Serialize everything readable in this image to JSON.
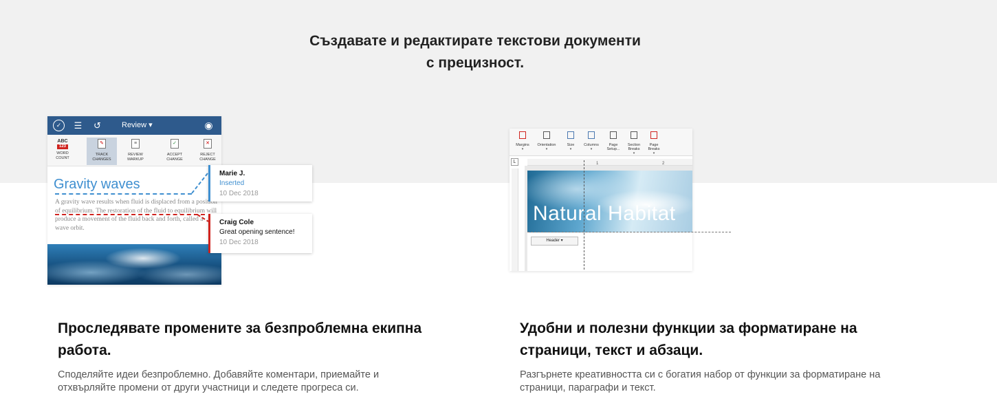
{
  "hero": {
    "line1": "Създавате и редактирате текстови документи",
    "line2": "с прецизност."
  },
  "mobile_mock": {
    "toolbar": {
      "icons": [
        "check-circle-icon",
        "list-icon",
        "undo-icon",
        "eye-icon"
      ],
      "menu_label": "Review ▾"
    },
    "tools": [
      {
        "label1": "WORD",
        "label2": "COUNT",
        "badge_top": "ABC",
        "badge_bottom": "123"
      },
      {
        "label1": "TRACK",
        "label2": "CHANGES",
        "active": true
      },
      {
        "label1": "REVIEW",
        "label2": "MARKUP"
      },
      {
        "label1": "ACCEPT",
        "label2": "CHANGE"
      },
      {
        "label1": "REJECT",
        "label2": "CHANGE"
      }
    ],
    "doc_title": "Gravity waves",
    "doc_body": "A gravity wave results when fluid is displaced from a position of equilibrium. The restoration of the fluid to equilibrium will produce a movement of the fluid back and forth, called a wave orbit.",
    "comments": [
      {
        "author": "Marie J.",
        "text": "Inserted",
        "date": "10 Dec 2018",
        "color": "#3f8fd0"
      },
      {
        "author": "Craig Cole",
        "text": "Great opening sentence!",
        "date": "10 Dec 2018",
        "color": "#d0231e"
      }
    ]
  },
  "desktop_mock": {
    "ribbon": [
      {
        "label": "Margins"
      },
      {
        "label": "Orientation"
      },
      {
        "label": "Size"
      },
      {
        "label": "Columns"
      },
      {
        "label": "Page Setup..."
      },
      {
        "label": "Section Breaks"
      },
      {
        "label": "Page Breaks"
      }
    ],
    "ruler_marks": [
      "1",
      "2"
    ],
    "corner_glyph": "L",
    "banner_title": "Natural Habitat",
    "header_button": "Header ▾"
  },
  "features": [
    {
      "title": "Проследявате промените за безпроблемна екипна работа.",
      "text": "Споделяйте идеи безпроблемно. Добавяйте коментари, приемайте и отхвърляйте промени от други участници и следете прогреса си."
    },
    {
      "title": "Удобни и полезни функции за форматиране на страници, текст и абзаци.",
      "text": "Разгърнете креативността си с богатия набор от функции за форматиране на страници, параграфи и текст."
    }
  ]
}
